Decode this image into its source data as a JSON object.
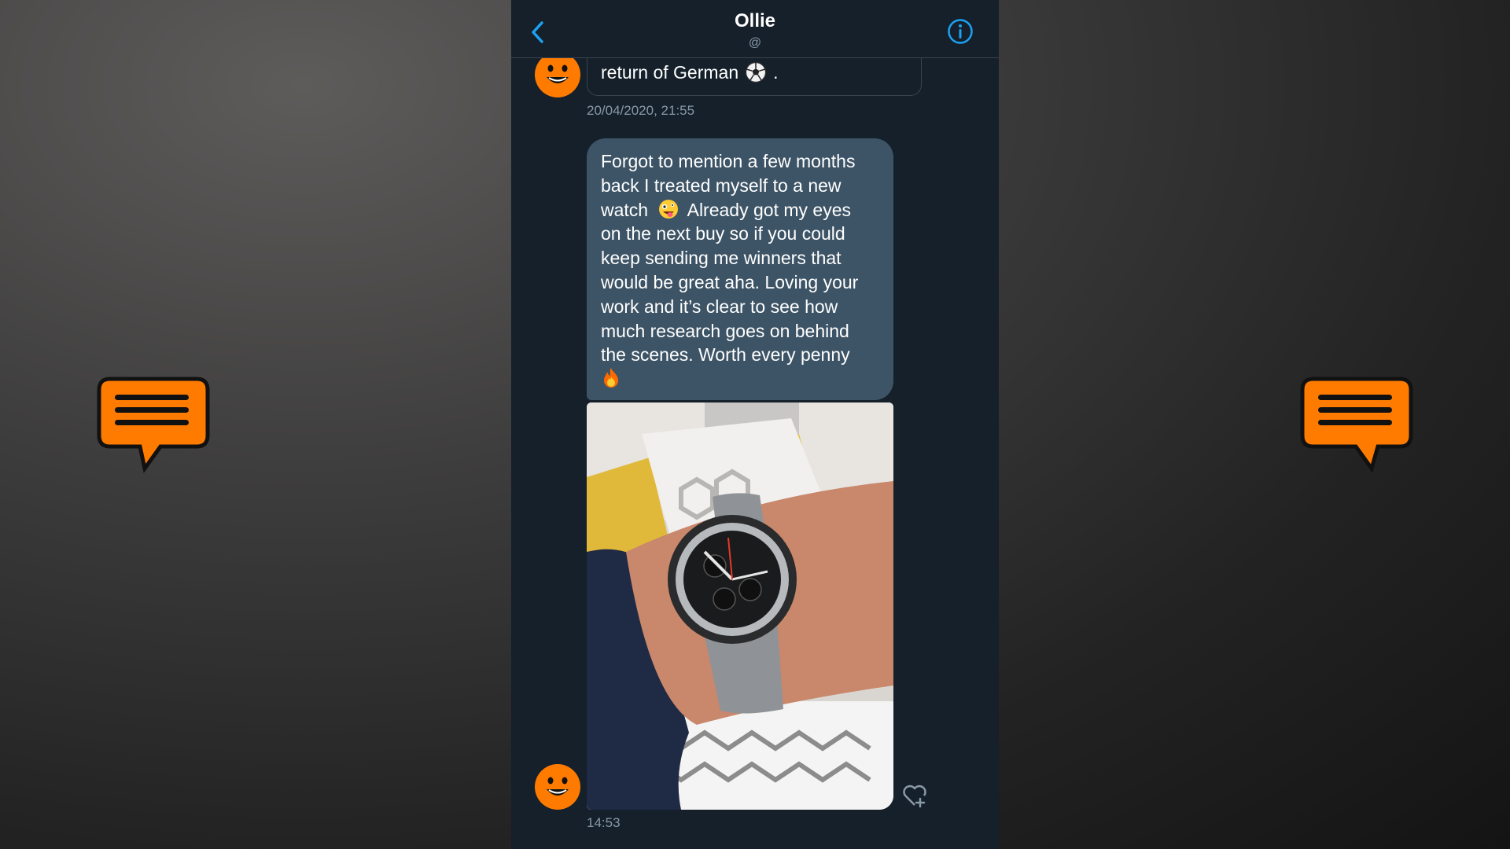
{
  "conversation": {
    "contact_name": "Ollie",
    "contact_handle": "@",
    "accent_color": "#1da1f2",
    "background_color": "#15202b"
  },
  "messages": [
    {
      "text": "return of German",
      "emoji": "soccer-ball-icon",
      "suffix": ".",
      "timestamp": "20/04/2020, 21:55"
    },
    {
      "lines": [
        "Forgot to mention a few months",
        "back I treated myself to a new",
        "watch",
        "Already got my eyes",
        "on the next buy so if you could",
        "keep sending me winners that",
        "would be great aha. Loving your",
        "work and it’s clear to see how",
        "much research goes on behind",
        "the scenes. Worth every penny"
      ],
      "emojis": [
        "zany-face-icon",
        "fire-icon"
      ],
      "attachment": "watch-photo",
      "timestamp": "14:53"
    }
  ]
}
